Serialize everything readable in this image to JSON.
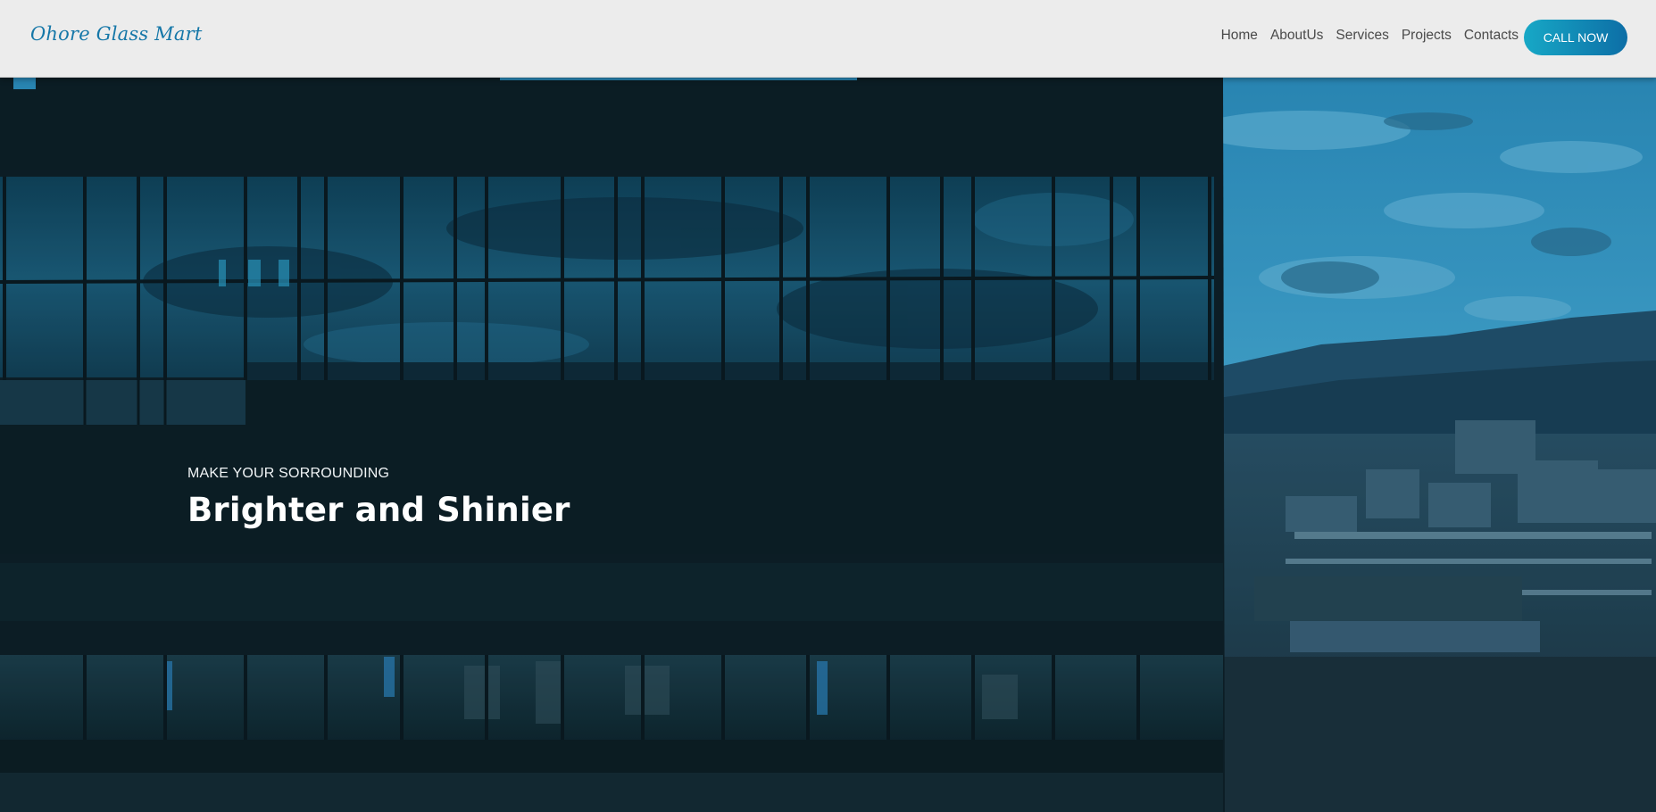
{
  "brand": {
    "name": "Ohore Glass Mart",
    "color": "#1577a8"
  },
  "nav": {
    "links": [
      "Home",
      "AboutUs",
      "Services",
      "Projects",
      "Contacts"
    ],
    "cta_label": "CALL NOW",
    "cta_gradient": [
      "#17a8c6",
      "#0d6ea6"
    ]
  },
  "hero": {
    "subtitle": "MAKE YOUR SORROUNDING",
    "title": "Brighter and Shinier",
    "overlay_color": "#0b1a1f",
    "sky_color": "#3a9cc9"
  }
}
